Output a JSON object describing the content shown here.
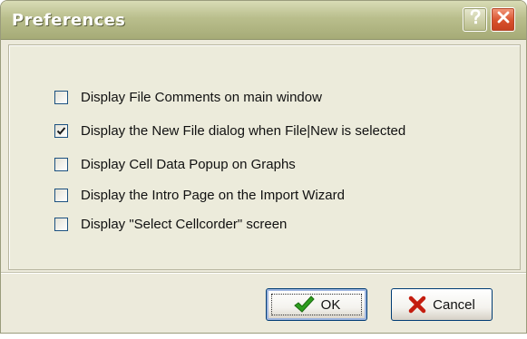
{
  "window": {
    "title": "Preferences",
    "help_icon": "question-mark-icon",
    "close_icon": "close-x-icon"
  },
  "options": [
    {
      "label": "Display File Comments on main window",
      "checked": false
    },
    {
      "label": "Display the New File dialog when File|New is selected",
      "checked": true
    },
    {
      "label": "Display Cell Data Popup on Graphs",
      "checked": false
    },
    {
      "label": "Display the Intro Page on the Import Wizard",
      "checked": false
    },
    {
      "label": "Display \"Select Cellcorder\" screen",
      "checked": false
    }
  ],
  "buttons": {
    "ok_label": "OK",
    "ok_icon": "green-checkmark-icon",
    "cancel_label": "Cancel",
    "cancel_icon": "red-x-icon"
  },
  "colors": {
    "titlebar": "#b9be8c",
    "dialog_background": "#eceadb",
    "close_button": "#d8512d",
    "ok_icon_green": "#2e9e1f",
    "cancel_icon_red": "#c41d0f"
  }
}
